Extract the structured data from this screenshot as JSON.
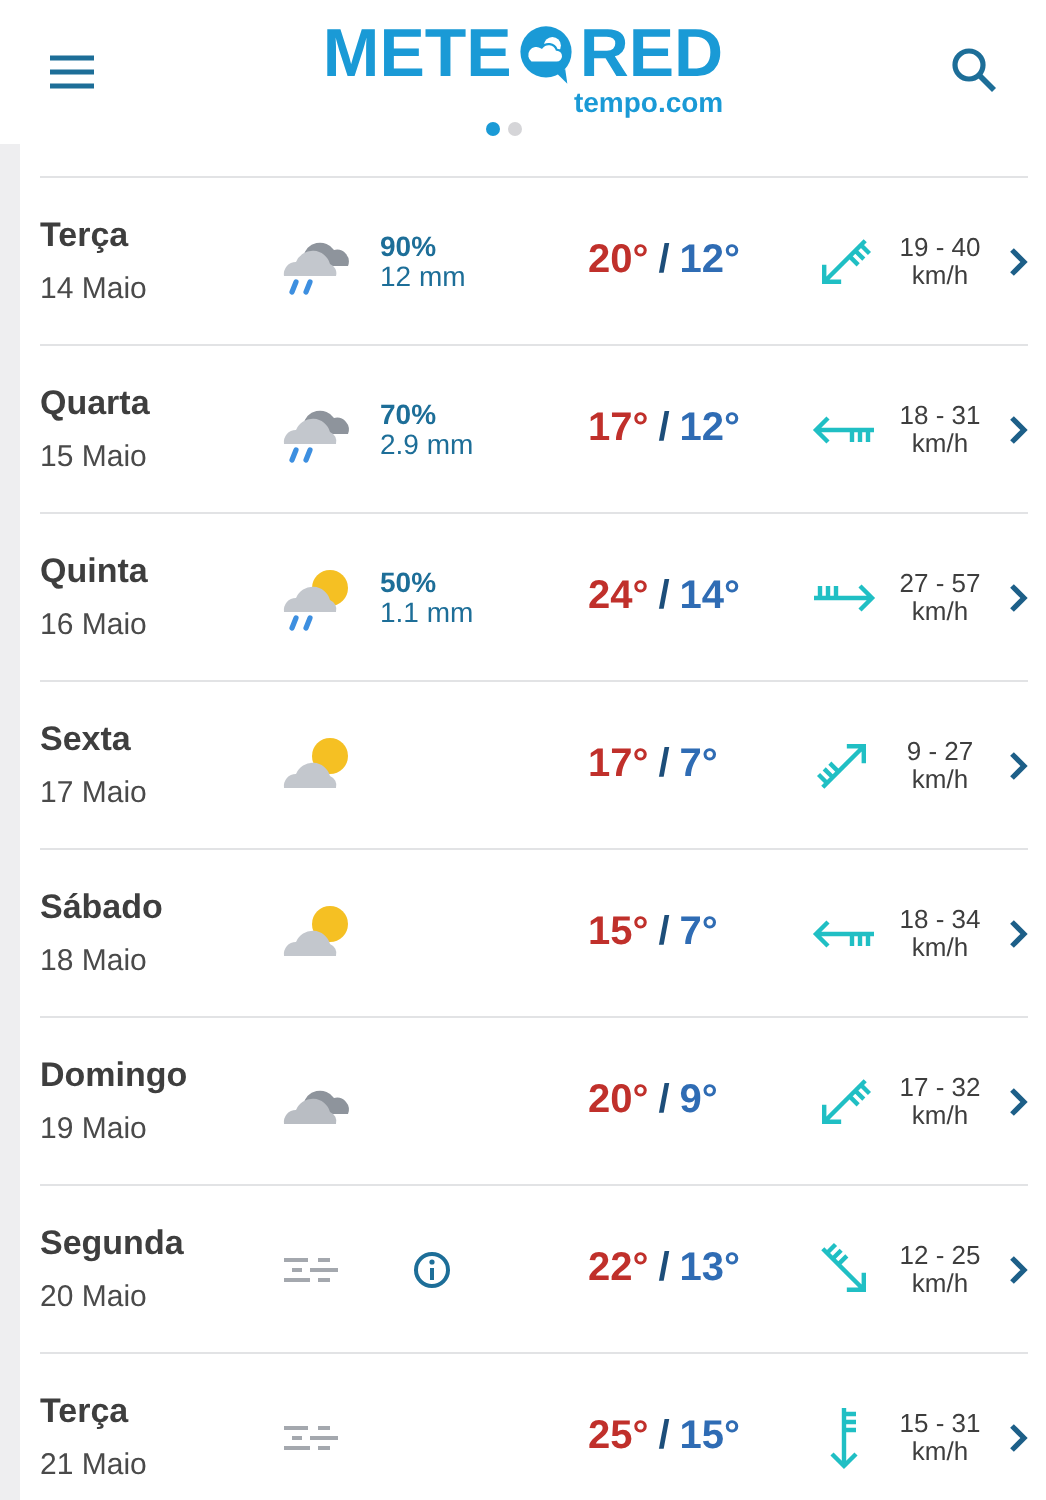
{
  "header": {
    "logo_left": "METE",
    "logo_right": "RED",
    "logo_sub": "tempo.com",
    "pager": [
      {
        "selected": true
      },
      {
        "selected": false
      }
    ]
  },
  "days": [
    {
      "day": "Terça",
      "date": "14 Maio",
      "weather": {
        "kind": "rain"
      },
      "chance": "90%",
      "amount": "12 mm",
      "info": false,
      "max": "20°",
      "separator": "/",
      "min": "12°",
      "wind_icon": {
        "kind": "sw"
      },
      "speed": "19 - 40",
      "unit": "km/h"
    },
    {
      "day": "Quarta",
      "date": "15 Maio",
      "weather": {
        "kind": "rain"
      },
      "chance": "70%",
      "amount": "2.9 mm",
      "info": false,
      "max": "17°",
      "separator": "/",
      "min": "12°",
      "wind_icon": {
        "kind": "w"
      },
      "speed": "18 - 31",
      "unit": "km/h"
    },
    {
      "day": "Quinta",
      "date": "16 Maio",
      "weather": {
        "kind": "sunrain"
      },
      "chance": "50%",
      "amount": "1.1 mm",
      "info": false,
      "max": "24°",
      "separator": "/",
      "min": "14°",
      "wind_icon": {
        "kind": "e"
      },
      "speed": "27 - 57",
      "unit": "km/h"
    },
    {
      "day": "Sexta",
      "date": "17 Maio",
      "weather": {
        "kind": "suncloud"
      },
      "info": false,
      "max": "17°",
      "separator": "/",
      "min": "7°",
      "wind_icon": {
        "kind": "ne"
      },
      "speed": "9 - 27",
      "unit": "km/h"
    },
    {
      "day": "Sábado",
      "date": "18 Maio",
      "weather": {
        "kind": "suncloud"
      },
      "info": false,
      "max": "15°",
      "separator": "/",
      "min": "7°",
      "wind_icon": {
        "kind": "w"
      },
      "speed": "18 - 34",
      "unit": "km/h"
    },
    {
      "day": "Domingo",
      "date": "19 Maio",
      "weather": {
        "kind": "cloud"
      },
      "info": false,
      "max": "20°",
      "separator": "/",
      "min": "9°",
      "wind_icon": {
        "kind": "sw"
      },
      "speed": "17 - 32",
      "unit": "km/h"
    },
    {
      "day": "Segunda",
      "date": "20 Maio",
      "weather": {
        "kind": "fog"
      },
      "info": true,
      "max": "22°",
      "separator": "/",
      "min": "13°",
      "wind_icon": {
        "kind": "se"
      },
      "speed": "12 - 25",
      "unit": "km/h"
    },
    {
      "day": "Terça",
      "date": "21 Maio",
      "weather": {
        "kind": "fog"
      },
      "info": false,
      "max": "25°",
      "separator": "/",
      "min": "15°",
      "wind_icon": {
        "kind": "s"
      },
      "speed": "15 - 31",
      "unit": "km/h"
    }
  ]
}
